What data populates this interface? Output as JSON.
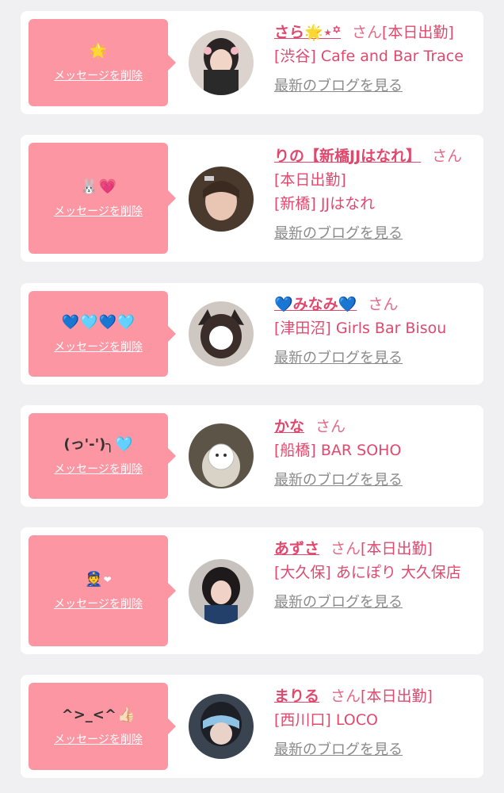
{
  "delete_label": "メッセージを削除",
  "blog_label": "最新のブログを見る",
  "san_label": "さん",
  "status_on_duty": "[本日出勤]",
  "cards": [
    {
      "message": [
        "🌟"
      ],
      "name_text": "さら",
      "name_suffix": "🌟⋆꙳",
      "shop_area": "[渋谷]",
      "shop_name": "Cafe and Bar Trace"
    },
    {
      "message": [
        "🐰",
        "💗"
      ],
      "name_text": "りの【新橋JJはなれ】",
      "name_suffix": "",
      "shop_area": "[新橋]",
      "shop_name": "JJはなれ"
    },
    {
      "message": [
        "💙",
        "🩵",
        "💙",
        "🩵"
      ],
      "name_text": "💙みなみ💙",
      "name_suffix": "",
      "shop_area": "[津田沼]",
      "shop_name": "Girls Bar Bisou"
    },
    {
      "message": [
        "(っ'-')╮",
        "🩵"
      ],
      "name_text": "かな",
      "name_suffix": "",
      "shop_area": "[船橋]",
      "shop_name": "BAR SOHO"
    },
    {
      "message": [
        "👮",
        "❤"
      ],
      "name_text": "あずさ",
      "name_suffix": "",
      "shop_area": "[大久保]",
      "shop_name": "あにぽり 大久保店"
    },
    {
      "message": [
        "^>_<^",
        "👍🏻"
      ],
      "name_text": "まりる",
      "name_suffix": "",
      "shop_area": "[西川口]",
      "shop_name": "LOCO"
    }
  ],
  "colors": {
    "bubble": "#fc96a2",
    "name": "#e0496e",
    "blog": "#8a8a8a",
    "background": "#f0f0f2"
  }
}
